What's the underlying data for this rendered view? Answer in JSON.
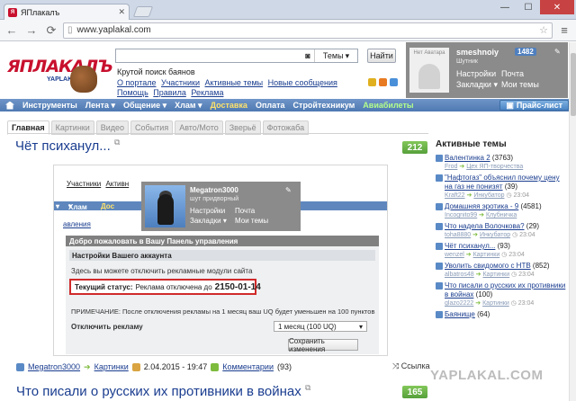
{
  "browser": {
    "tab_title": "ЯПлакалъ",
    "url": "www.yaplakal.com"
  },
  "header": {
    "logo_text": "ЯПЛАКАЛЪ",
    "logo_domain": "YAPLAKAL.COM",
    "search_placeholder": "",
    "search_scope": "Темы",
    "search_button": "Найти",
    "tagline": "Крутой поиск баянов",
    "links": [
      "О портале",
      "Участники",
      "Активные темы",
      "Новые сообщения",
      "Помощь",
      "Правила",
      "Реклама"
    ]
  },
  "user": {
    "avatar_text": "Нет Аватара",
    "name": "smeshnoiy",
    "count": "1482",
    "rank": "Шутник",
    "settings": "Настройки",
    "mail": "Почта",
    "bookmarks": "Закладки",
    "mythemes": "Мои темы"
  },
  "nav": {
    "items": [
      "Инструменты",
      "Лента",
      "Общение",
      "Хлам",
      "Доставка",
      "Оплата",
      "Стройтехникум",
      "Авиабилеты"
    ],
    "pricelist": "Прайс-лист"
  },
  "tabs": [
    "Главная",
    "Картинки",
    "Видео",
    "События",
    "Авто/Мото",
    "Зверьё",
    "Фотожаба"
  ],
  "post": {
    "title": "Чёт психанул...",
    "score": "212",
    "author": "Megatron3000",
    "category": "Картинки",
    "date": "2.04.2015 - 19:47",
    "comments_label": "Комментарии",
    "comments_count": "(93)",
    "share": "Ссылка"
  },
  "screenshot": {
    "links": [
      "Участники",
      "Активн"
    ],
    "nav": [
      "Хлам",
      "Дос"
    ],
    "breadcrumb": "авления",
    "popup_name": "Megatron3000",
    "popup_rank": "шут придворный",
    "popup_settings": "Настройки",
    "popup_mail": "Почта",
    "popup_bookmarks": "Закладки",
    "popup_mythemes": "Мои темы",
    "panel_header": "Добро пожаловать в Вашу Панель управления",
    "panel_sub": "Настройки Вашего аккаунта",
    "panel_text": "Здесь вы можете отключить рекламные модули сайта",
    "status_label": "Текущий статус:",
    "status_text": "Реклама отключена до",
    "status_date": "2150-01-14",
    "note": "ПРИМЕЧАНИЕ: После отключения рекламы на 1 месяц ваш UQ будет уменьшен на 100 пунктов",
    "disable_label": "Отключить рекламу",
    "select_value": "1 месяц (100 UQ)",
    "save_button": "Сохранить изменения"
  },
  "next_post": {
    "title": "Что писали о русских их противники в войнах",
    "score": "165"
  },
  "sidebar": {
    "title": "Активные темы",
    "items": [
      {
        "title": "Валентинка 2",
        "count": "(3763)",
        "user": "Frod",
        "section": "Цех ЯП-творчества",
        "time": ""
      },
      {
        "title": "\"Нафтогаз\" объяснил почему цену на газ не понизят",
        "count": "(39)",
        "user": "Kraft22",
        "section": "Инкубатор",
        "time": "23:04"
      },
      {
        "title": "Домашняя эротика - 9",
        "count": "(4581)",
        "user": "Incognito99",
        "section": "Клубничка",
        "time": ""
      },
      {
        "title": "Что надела Волочкова?",
        "count": "(29)",
        "user": "toha8880",
        "section": "Инкубатор",
        "time": "23:04"
      },
      {
        "title": "Чёт психанул...",
        "count": "(93)",
        "user": "wenzel",
        "section": "Картинки",
        "time": "23:04"
      },
      {
        "title": "Уволить свидомого с НТВ",
        "count": "(852)",
        "user": "albatros48",
        "section": "Картинки",
        "time": "23:04"
      },
      {
        "title": "Что писали о русских их противники в войнах",
        "count": "(100)",
        "user": "glazo2222",
        "section": "Картинки",
        "time": "23:04"
      },
      {
        "title": "Баянище",
        "count": "(64)",
        "user": "",
        "section": "",
        "time": ""
      }
    ]
  },
  "watermark": "YAPLAKAL.COM",
  "colors": {
    "brand_red": "#c8102e",
    "nav_blue": "#4e79b2",
    "score_green": "#56a03a",
    "status_border": "#d02a2a"
  }
}
